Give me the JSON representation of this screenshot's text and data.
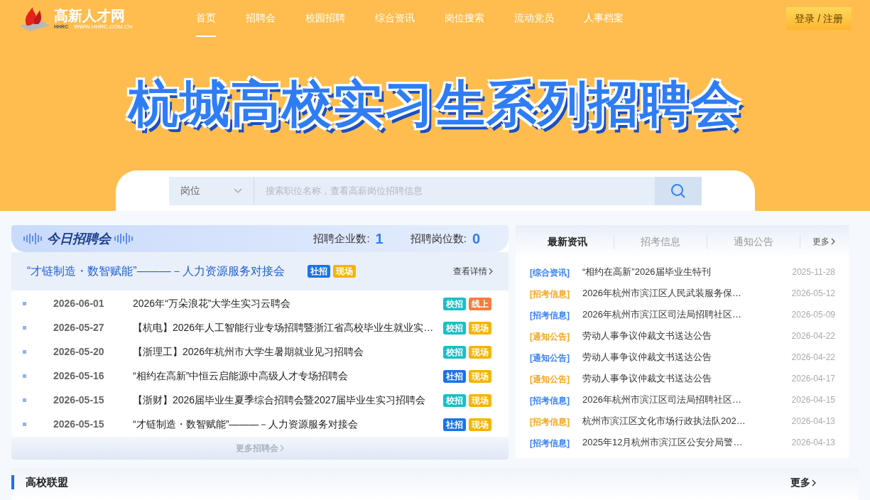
{
  "header": {
    "logo": {
      "name": "高新人才网",
      "abbr": "HHRC",
      "url": "WWW.HHRC.COM.CN"
    },
    "nav": [
      {
        "label": "首页",
        "selected": true
      },
      {
        "label": "招聘会",
        "selected": false
      },
      {
        "label": "校园招聘",
        "selected": false
      },
      {
        "label": "综合资讯",
        "selected": false
      },
      {
        "label": "岗位搜索",
        "selected": false
      },
      {
        "label": "流动党员",
        "selected": false
      },
      {
        "label": "人事档案",
        "selected": false
      }
    ],
    "login_button": "登录 / 注册"
  },
  "banner": {
    "title": "杭城高校实习生系列招聘会"
  },
  "search": {
    "category": "岗位",
    "placeholder": "搜索职位名称，查看高薪岗位招聘信息"
  },
  "fairs": {
    "title": "今日招聘会",
    "stats": [
      {
        "label": "招聘企业数:",
        "value": "1"
      },
      {
        "label": "招聘岗位数:",
        "value": "0"
      }
    ],
    "featured": {
      "title": "“才链制造・数智赋能”———－人力资源服务对接会",
      "tags": [
        {
          "label": "社招",
          "color": "#1a73e8"
        },
        {
          "label": "现场",
          "color": "#f5b400"
        }
      ],
      "link": "查看详情"
    },
    "items": [
      {
        "date": "2026-06-01",
        "title": "2026年“万朵浪花”大学生实习云聘会",
        "tags": [
          {
            "label": "校招",
            "color": "#17bfc6"
          },
          {
            "label": "线上",
            "color": "#f47c3c"
          }
        ]
      },
      {
        "date": "2026-05-27",
        "title": "【杭电】2026年人工智能行业专场招聘暨浙江省高校毕业生就业实…",
        "tags": [
          {
            "label": "校招",
            "color": "#17bfc6"
          },
          {
            "label": "现场",
            "color": "#f5b400"
          }
        ]
      },
      {
        "date": "2026-05-20",
        "title": "【浙理工】2026年杭州市大学生暑期就业见习招聘会",
        "tags": [
          {
            "label": "校招",
            "color": "#17bfc6"
          },
          {
            "label": "现场",
            "color": "#f5b400"
          }
        ]
      },
      {
        "date": "2026-05-16",
        "title": "“相约在高新”中恒云启能源中高级人才专场招聘会",
        "tags": [
          {
            "label": "社招",
            "color": "#1a73e8"
          },
          {
            "label": "现场",
            "color": "#f5b400"
          }
        ]
      },
      {
        "date": "2026-05-15",
        "title": "【浙财】2026届毕业生夏季综合招聘会暨2027届毕业生实习招聘会",
        "tags": [
          {
            "label": "校招",
            "color": "#17bfc6"
          },
          {
            "label": "现场",
            "color": "#f5b400"
          }
        ]
      },
      {
        "date": "2026-05-15",
        "title": "“才链制造・数智赋能”———－人力资源服务对接会",
        "tags": [
          {
            "label": "社招",
            "color": "#1a73e8"
          },
          {
            "label": "现场",
            "color": "#f5b400"
          }
        ]
      }
    ],
    "more": "更多招聘会"
  },
  "news": {
    "tabs": [
      {
        "label": "最新资讯",
        "selected": true
      },
      {
        "label": "招考信息",
        "selected": false
      },
      {
        "label": "通知公告",
        "selected": false
      }
    ],
    "more": "更多",
    "items": [
      {
        "category": "[综合资讯]",
        "color": "#3b82f6",
        "title": "“相约在高新”2026届毕业生特刊",
        "date": "2025-11-28"
      },
      {
        "category": "[招考信息]",
        "color": "#f5a623",
        "title": "2026年杭州市滨江区人民武装服务保…",
        "date": "2026-05-12"
      },
      {
        "category": "[招考信息]",
        "color": "#3b82f6",
        "title": "2026年杭州市滨江区司法局招聘社区…",
        "date": "2026-05-09"
      },
      {
        "category": "[通知公告]",
        "color": "#f5a623",
        "title": "劳动人事争议仲裁文书送达公告",
        "date": "2026-04-22"
      },
      {
        "category": "[通知公告]",
        "color": "#3b82f6",
        "title": "劳动人事争议仲裁文书送达公告",
        "date": "2026-04-22"
      },
      {
        "category": "[通知公告]",
        "color": "#f5a623",
        "title": "劳动人事争议仲裁文书送达公告",
        "date": "2026-04-17"
      },
      {
        "category": "[招考信息]",
        "color": "#3b82f6",
        "title": "2026年杭州市滨江区司法局招聘社区…",
        "date": "2026-04-15"
      },
      {
        "category": "[招考信息]",
        "color": "#f5a623",
        "title": "杭州市滨江区文化市场行政执法队202…",
        "date": "2026-04-13"
      },
      {
        "category": "[招考信息]",
        "color": "#3b82f6",
        "title": "2025年12月杭州市滨江区公安分局警…",
        "date": "2026-04-13"
      }
    ]
  },
  "alliance": {
    "title": "高校联盟",
    "more": "更多"
  }
}
